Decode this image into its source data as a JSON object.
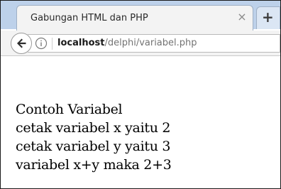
{
  "tab": {
    "title": "Gabungan HTML dan PHP",
    "close_glyph": "×",
    "new_tab_glyph": "+"
  },
  "navigation": {
    "back_icon": "back-arrow-icon",
    "info_icon": "info-icon",
    "url_host": "localhost",
    "url_path": "/delphi/variabel.php"
  },
  "page": {
    "lines": [
      "Contoh Variabel",
      "cetak variabel x yaitu 2",
      "cetak variabel y yaitu 3",
      "variabel x+y maka 2+3"
    ]
  }
}
